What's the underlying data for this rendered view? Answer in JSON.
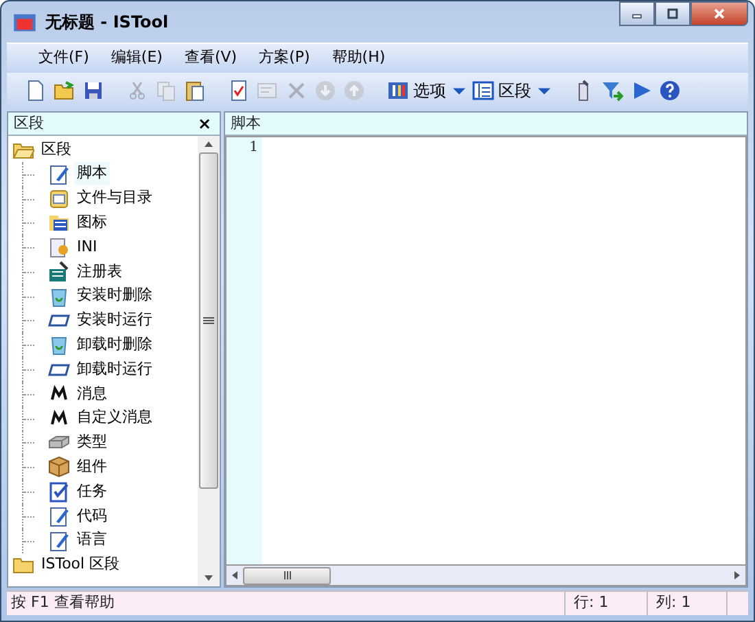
{
  "window": {
    "title": "无标题 - ISTool"
  },
  "menu": [
    {
      "label": "文件(F)"
    },
    {
      "label": "编辑(E)"
    },
    {
      "label": "查看(V)"
    },
    {
      "label": "方案(P)"
    },
    {
      "label": "帮助(H)"
    }
  ],
  "toolbar": [
    {
      "kind": "new",
      "disabled": false
    },
    {
      "kind": "open",
      "disabled": false
    },
    {
      "kind": "save",
      "disabled": false
    },
    {
      "kind": "sep"
    },
    {
      "kind": "cut",
      "disabled": true
    },
    {
      "kind": "copy",
      "disabled": true
    },
    {
      "kind": "paste",
      "disabled": false
    },
    {
      "kind": "sep"
    },
    {
      "kind": "check",
      "disabled": false
    },
    {
      "kind": "edit",
      "disabled": true
    },
    {
      "kind": "delete",
      "disabled": true
    },
    {
      "kind": "down",
      "disabled": true
    },
    {
      "kind": "up",
      "disabled": true
    },
    {
      "kind": "sep"
    },
    {
      "kind": "options",
      "label": "选项",
      "disabled": false
    },
    {
      "kind": "dropdown",
      "disabled": false
    },
    {
      "kind": "sections",
      "label": "区段",
      "disabled": false
    },
    {
      "kind": "dropdown",
      "disabled": false
    },
    {
      "kind": "sep"
    },
    {
      "kind": "compile",
      "disabled": false
    },
    {
      "kind": "funnel",
      "disabled": false
    },
    {
      "kind": "run",
      "disabled": false
    },
    {
      "kind": "help",
      "disabled": false
    }
  ],
  "sidebar": {
    "title": "区段",
    "close": "×",
    "tree": [
      {
        "label": "区段",
        "kind": "folder",
        "expanded": true,
        "selected": false,
        "children": [
          {
            "label": "脚本",
            "kind": "script",
            "selected": true
          },
          {
            "label": "文件与目录",
            "kind": "files",
            "selected": false
          },
          {
            "label": "图标",
            "kind": "icons",
            "selected": false
          },
          {
            "label": "INI",
            "kind": "ini",
            "selected": false
          },
          {
            "label": "注册表",
            "kind": "registry",
            "selected": false
          },
          {
            "label": "安装时删除",
            "kind": "delete",
            "selected": false
          },
          {
            "label": "安装时运行",
            "kind": "run",
            "selected": false
          },
          {
            "label": "卸载时删除",
            "kind": "delete",
            "selected": false
          },
          {
            "label": "卸载时运行",
            "kind": "run",
            "selected": false
          },
          {
            "label": "消息",
            "kind": "message",
            "selected": false
          },
          {
            "label": "自定义消息",
            "kind": "message",
            "selected": false
          },
          {
            "label": "类型",
            "kind": "types",
            "selected": false
          },
          {
            "label": "组件",
            "kind": "components",
            "selected": false
          },
          {
            "label": "任务",
            "kind": "tasks",
            "selected": false
          },
          {
            "label": "代码",
            "kind": "script",
            "selected": false
          },
          {
            "label": "语言",
            "kind": "script",
            "selected": false
          }
        ]
      },
      {
        "label": "ISTool 区段",
        "kind": "folder",
        "expanded": false,
        "selected": false
      }
    ]
  },
  "editor": {
    "title": "脚本",
    "lines": [
      {
        "number": "1"
      }
    ]
  },
  "status_bar": {
    "message": "按 F1 查看帮助",
    "row": "行: 1",
    "column": "列: 1"
  }
}
